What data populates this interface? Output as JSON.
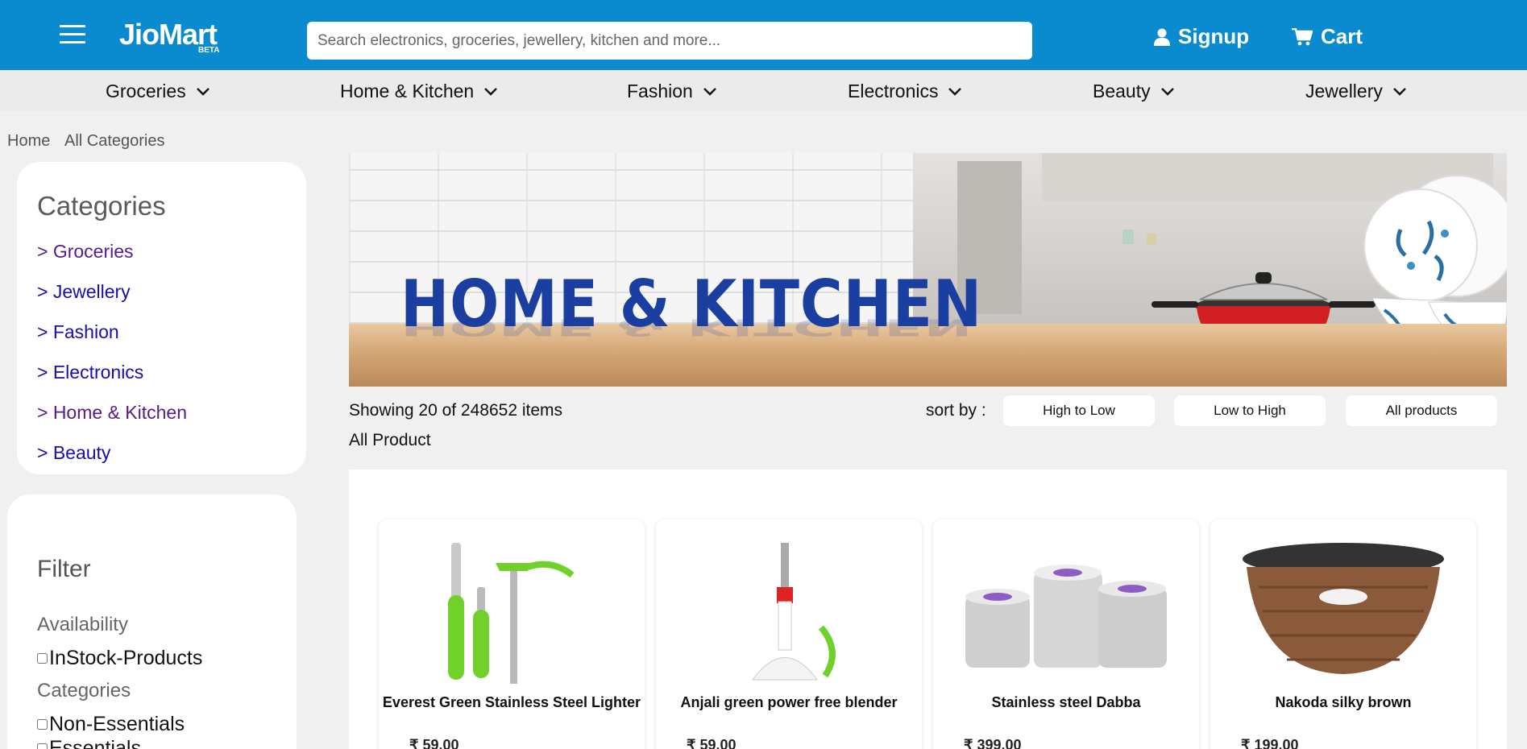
{
  "header": {
    "logo": "JioMart",
    "logo_badge": "BETA",
    "search_placeholder": "Search electronics, groceries, jewellery, kitchen and more...",
    "signup_label": "Signup",
    "cart_label": "Cart"
  },
  "nav": {
    "items": [
      "Groceries",
      "Home & Kitchen",
      "Fashion",
      "Electronics",
      "Beauty",
      "Jewellery"
    ]
  },
  "breadcrumb": [
    "Home",
    "All Categories"
  ],
  "sidebar": {
    "categories_title": "Categories",
    "categories": [
      "> Groceries",
      "> Jewellery",
      "> Fashion",
      "> Electronics",
      "> Home & Kitchen",
      "> Beauty"
    ],
    "filter_title": "Filter",
    "availability_label": "Availability",
    "availability_option": "InStock-Products",
    "categories_label": "Categories",
    "category_options": [
      "Non-Essentials",
      "Essentials"
    ]
  },
  "banner": {
    "title": "HOME & KITCHEN"
  },
  "results": {
    "showing": "Showing 20 of 248652 items",
    "section_label": "All Product",
    "sort_label": "sort by :",
    "sort_options": [
      "High to Low",
      "Low to High",
      "All products"
    ]
  },
  "products": [
    {
      "name": "Everest Green Stainless Steel Lighter",
      "price": "₹ 59.00"
    },
    {
      "name": "Anjali green power free blender",
      "price": "₹ 59.00"
    },
    {
      "name": "Stainless steel Dabba",
      "price": "₹ 399.00"
    },
    {
      "name": "Nakoda silky brown",
      "price": "₹ 199.00"
    }
  ],
  "colors": {
    "header_bg": "#0a8bd0",
    "banner_text": "#1a3fa0",
    "link": "#1a0dab",
    "visited_link": "#551a8b"
  }
}
